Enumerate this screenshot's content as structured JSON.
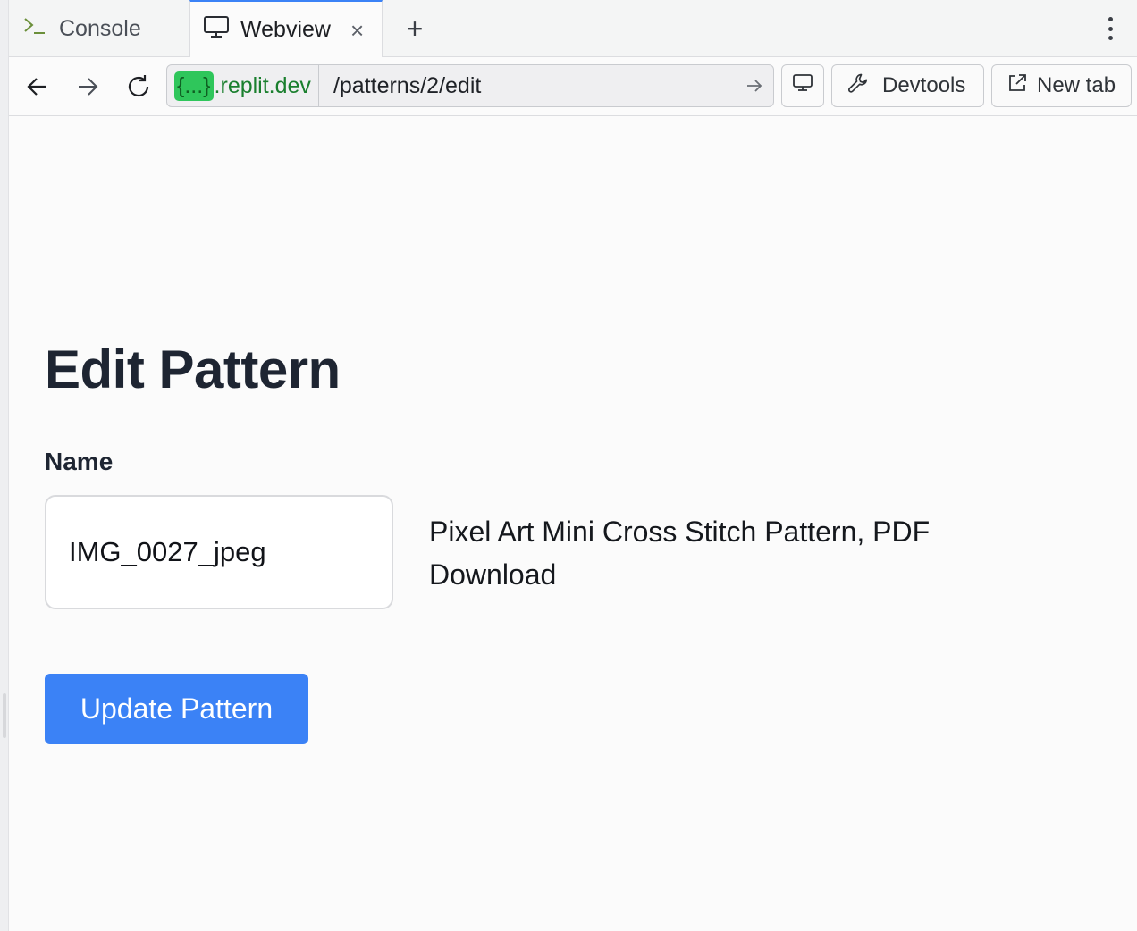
{
  "tabs": [
    {
      "label": "Console",
      "icon": "terminal-prompt-icon",
      "active": false
    },
    {
      "label": "Webview",
      "icon": "monitor-icon",
      "active": true,
      "close_glyph": "×"
    }
  ],
  "add_tab_glyph": "+",
  "address_bar": {
    "host_badge": "{...}",
    "host_suffix": ".replit.dev",
    "path": "/patterns/2/edit"
  },
  "toolbar": {
    "devtools_label": "Devtools",
    "new_tab_label": "New tab"
  },
  "page": {
    "title": "Edit Pattern",
    "name_label": "Name",
    "name_value": "IMG_0027_jpeg",
    "description": "Pixel Art Mini Cross Stitch Pattern, PDF Download",
    "submit_label": "Update Pattern"
  },
  "colors": {
    "accent": "#3b82f6",
    "host_green": "#1a7f2e",
    "badge_green": "#2fc65b",
    "title_text": "#1e2532"
  }
}
